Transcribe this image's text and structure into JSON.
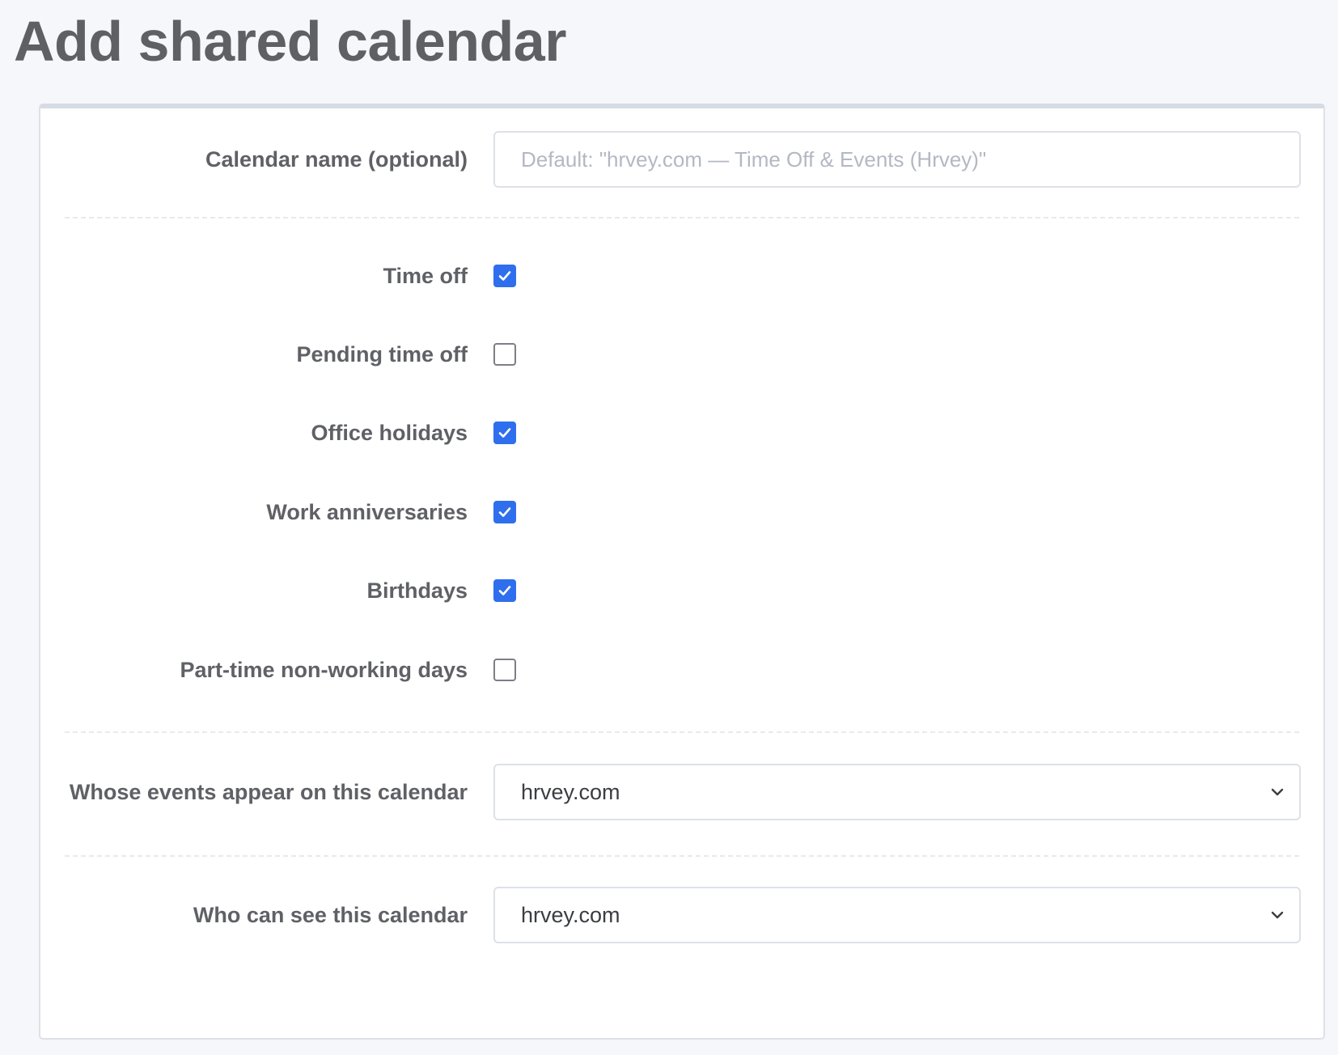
{
  "page": {
    "title": "Add shared calendar"
  },
  "form": {
    "calendar_name": {
      "label": "Calendar name (optional)",
      "value": "",
      "placeholder": "Default: \"hrvey.com — Time Off & Events (Hrvey)\""
    },
    "options": [
      {
        "label": "Time off",
        "checked": true
      },
      {
        "label": "Pending time off",
        "checked": false
      },
      {
        "label": "Office holidays",
        "checked": true
      },
      {
        "label": "Work anniversaries",
        "checked": true
      },
      {
        "label": "Birthdays",
        "checked": true
      },
      {
        "label": "Part-time non-working days",
        "checked": false
      }
    ],
    "events_source": {
      "label": "Whose events appear on this calendar",
      "selected": "hrvey.com"
    },
    "visibility": {
      "label": "Who can see this calendar",
      "selected": "hrvey.com"
    }
  },
  "colors": {
    "checkbox_checked": "#2f6fed",
    "page_background": "#f6f7fb",
    "card_background": "#ffffff"
  },
  "icons": {
    "checkmark": "check-icon",
    "select_arrow": "chevron-down-icon"
  }
}
